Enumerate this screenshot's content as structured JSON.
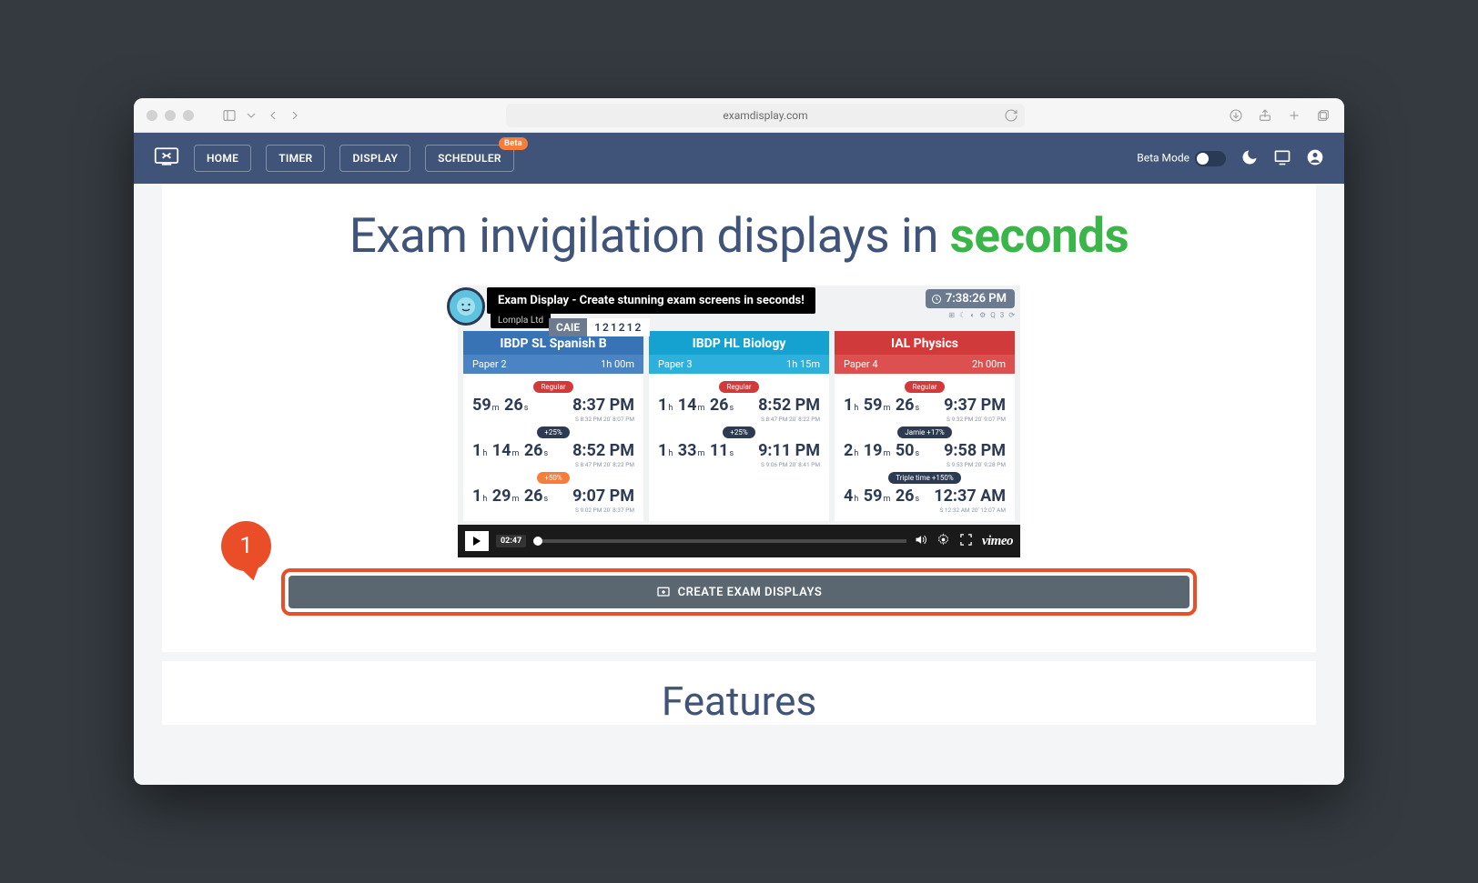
{
  "browser": {
    "url": "examdisplay.com"
  },
  "nav": {
    "items": [
      "HOME",
      "TIMER",
      "DISPLAY",
      "SCHEDULER"
    ],
    "beta_badge": "Beta",
    "beta_mode_label": "Beta Mode"
  },
  "headline": {
    "pre": "Exam invigilation displays in ",
    "strong": "seconds"
  },
  "video": {
    "tooltip_title": "Exam Display - Create stunning exam screens in seconds!",
    "tooltip_sub": "Lompla Ltd",
    "clock": "7:38:26 PM",
    "pill_label": "CAIE",
    "pill_code": "121212",
    "mini_icons": [
      "⊞",
      "☾",
      "◐",
      "⚙",
      "Q",
      "3",
      "⟳"
    ],
    "play_time": "02:47",
    "provider": "vimeo",
    "cards": [
      {
        "title": "IBDP SL Spanish B",
        "paper": "Paper 2",
        "dur": "1h 00m",
        "color": "blue",
        "rows": [
          {
            "tag": "Regular",
            "tagc": "red",
            "l": "59<small>m</small> 26<small>s</small>",
            "r": "8:37 PM",
            "tiny": "S 8:32 PM   20' 8:07 PM"
          },
          {
            "tag": "+25%",
            "tagc": "navy",
            "l": "1<small>h</small> 14<small>m</small> 26<small>s</small>",
            "r": "8:52 PM",
            "tiny": "S 8:47 PM   20' 8:22 PM"
          },
          {
            "tag": "+50%",
            "tagc": "orange",
            "l": "1<small>h</small> 29<small>m</small> 26<small>s</small>",
            "r": "9:07 PM",
            "tiny": "S 9:02 PM   20' 8:37 PM"
          }
        ]
      },
      {
        "title": "IBDP HL Biology",
        "paper": "Paper 3",
        "dur": "1h 15m",
        "color": "teal",
        "rows": [
          {
            "tag": "Regular",
            "tagc": "red",
            "l": "1<small>h</small> 14<small>m</small> 26<small>s</small>",
            "r": "8:52 PM",
            "tiny": "S 8:47 PM   20' 8:22 PM"
          },
          {
            "tag": "+25%",
            "tagc": "navy",
            "l": "1<small>h</small> 33<small>m</small> 11<small>s</small>",
            "r": "9:11 PM",
            "tiny": "S 9:06 PM   20' 8:41 PM"
          }
        ]
      },
      {
        "title": "IAL Physics",
        "paper": "Paper 4",
        "dur": "2h 00m",
        "color": "red",
        "rows": [
          {
            "tag": "Regular",
            "tagc": "red",
            "l": "1<small>h</small> 59<small>m</small> 26<small>s</small>",
            "r": "9:37 PM",
            "tiny": "S 9:32 PM   20' 9:07 PM"
          },
          {
            "tag": "Jamie +17%",
            "tagc": "navy",
            "l": "2<small>h</small> 19<small>m</small> 50<small>s</small>",
            "r": "9:58 PM",
            "tiny": "S 9:53 PM   20' 9:28 PM"
          },
          {
            "tag": "Triple time +150%",
            "tagc": "navy",
            "l": "4<small>h</small> 59<small>m</small> 26<small>s</small>",
            "r": "12:37 AM",
            "tiny": "S 12:32 AM   20' 12:07 AM"
          }
        ]
      }
    ]
  },
  "callout": {
    "num": "1"
  },
  "cta": {
    "label": "CREATE EXAM DISPLAYS"
  },
  "features": {
    "heading": "Features"
  }
}
